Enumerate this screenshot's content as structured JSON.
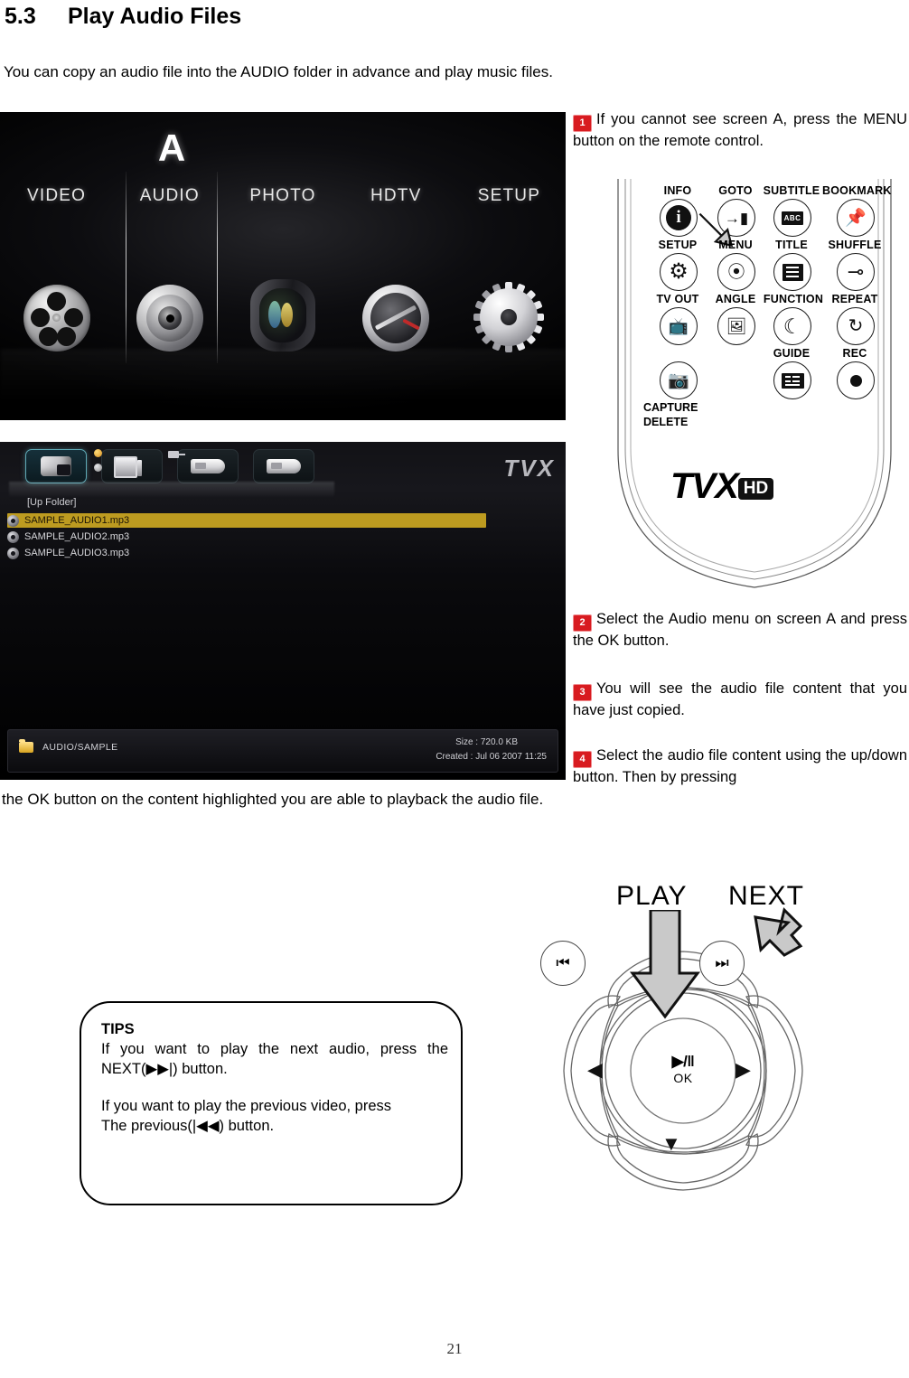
{
  "document": {
    "section_number": "5.3",
    "section_title": "Play Audio Files",
    "intro": "You can copy an audio file into the AUDIO folder in advance and play music files.",
    "page_number": "21"
  },
  "screen_a": {
    "overlay_letter": "A",
    "menu_items": [
      "VIDEO",
      "AUDIO",
      "PHOTO",
      "HDTV",
      "SETUP"
    ],
    "icons": [
      "film-reel-icon",
      "speaker-icon",
      "camera-lens-icon",
      "dial-icon",
      "gear-icon"
    ]
  },
  "file_browser": {
    "device_tabs": [
      "hdd-tab",
      "network-tab",
      "usb-tab-1",
      "usb-tab-2"
    ],
    "selected_tab_index": 0,
    "brand_logo": "TVX",
    "up_folder": "[Up Folder]",
    "files": [
      {
        "name": "SAMPLE_AUDIO1.mp3",
        "highlighted": true
      },
      {
        "name": "SAMPLE_AUDIO2.mp3",
        "highlighted": false
      },
      {
        "name": "SAMPLE_AUDIO3.mp3",
        "highlighted": false
      }
    ],
    "status_bar": {
      "path": "AUDIO/SAMPLE",
      "size": "Size : 720.0 KB",
      "created": "Created  :  Jul 06  2007   11:25"
    },
    "highlight_color": "#bd9b20"
  },
  "steps": [
    {
      "num": "1",
      "text": "If you cannot see screen A, press the MENU button on the remote control."
    },
    {
      "num": "2",
      "text": "Select the Audio menu on screen A and press the OK button."
    },
    {
      "num": "3",
      "text": "You will see the audio file content that you have just copied."
    },
    {
      "num": "4",
      "text": "Select the audio file content using the up/down button. Then by pressing"
    }
  ],
  "continuation_line": "the OK button on the content highlighted    you are able to    playback   the audio file.",
  "remote": {
    "labels": {
      "info": "INFO",
      "goto": "GOTO",
      "subtitle": "SUBTITLE",
      "bookmark": "BOOKMARK",
      "setup": "SETUP",
      "menu": "MENU",
      "title": "TITLE",
      "shuffle": "SHUFFLE",
      "tv_out": "TV OUT",
      "angle": "ANGLE",
      "function": "FUNCTION",
      "repeat": "REPEAT",
      "guide": "GUIDE",
      "rec": "REC",
      "capture": "CAPTURE",
      "delete": "DELETE"
    },
    "glyphs": {
      "info": "i",
      "goto": "→|",
      "subtitle": "ABC",
      "bookmark": "📌",
      "setup": "⚙",
      "title": "☰",
      "shuffle": "✗",
      "tv_out": "▶",
      "angle": "↻",
      "function": "☾",
      "repeat": "↺",
      "guide": "☰",
      "rec": "●"
    },
    "brand": "TVX",
    "brand_tag": "HD",
    "callout_arrow_target": "MENU"
  },
  "tips": {
    "title": "TIPS",
    "line1": "If you want to play the next audio, press the NEXT(▶▶|) button.",
    "line2": "If you want to play the previous video, press",
    "line3": "The previous(|◀◀) button."
  },
  "navpad": {
    "label_play": "PLAY",
    "label_next": "NEXT",
    "prev_button": "⏮",
    "next_button": "⏭",
    "left_arrow": "◀",
    "right_arrow": "▶",
    "down_arrow": "▼",
    "center_play_pause": "▶/‖",
    "center_ok": "OK"
  }
}
